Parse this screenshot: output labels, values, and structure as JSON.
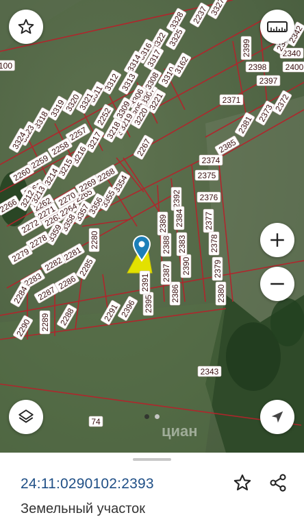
{
  "map": {
    "scale_icon": "ruler-icon",
    "layers_icon": "layers-icon",
    "locate_icon": "navigation-arrow-icon",
    "favorite_icon": "star-outline-icon",
    "zoom_in_icon": "plus-icon",
    "zoom_out_icon": "minus-icon",
    "watermark": "циан",
    "colors": {
      "boundary": "#b4232b",
      "selected_fill": "#e3e100",
      "marker": "#1c7fb8"
    },
    "parcels": [
      "3328",
      "2237",
      "3327",
      "3325",
      "3322",
      "3317",
      "3316",
      "3314",
      "3313",
      "3312",
      "3311",
      "3318",
      "3319",
      "3320",
      "3321",
      "3323",
      "3324",
      "3310",
      "3307",
      "3308",
      "3306",
      "3309",
      "3162",
      "3304",
      "3305",
      "3221",
      "3219",
      "3220",
      "2252",
      "3218",
      "3217",
      "3216",
      "3215",
      "3214",
      "2257",
      "2258",
      "2259",
      "2260",
      "2261",
      "2262",
      "2263",
      "2264",
      "2265",
      "2266",
      "2267",
      "2268",
      "2269",
      "2270",
      "2271",
      "2272",
      "3213",
      "3212",
      "3354",
      "3355",
      "3356",
      "3357",
      "3358",
      "3359",
      "2278",
      "2279",
      "2280",
      "2281",
      "2282",
      "2283",
      "2284",
      "2285",
      "2286",
      "2287",
      "2288",
      "2289",
      "2290",
      "2291",
      "2396",
      "2395",
      "2391",
      "2392",
      "2386",
      "2387",
      "2388",
      "2389",
      "2390",
      "2383",
      "2384",
      "2385",
      "2374",
      "2375",
      "2376",
      "2377",
      "2378",
      "2379",
      "2380",
      "2381",
      "2373",
      "2372",
      "2371",
      "2397",
      "2398",
      "2399",
      "2400",
      "2340",
      "2341",
      "2342",
      "2343",
      "74",
      "100"
    ]
  },
  "pager": {
    "active_index": 0,
    "count": 2
  },
  "parcel": {
    "cadastral_number": "24:11:0290102:2393",
    "kind": "Земельный участок"
  }
}
